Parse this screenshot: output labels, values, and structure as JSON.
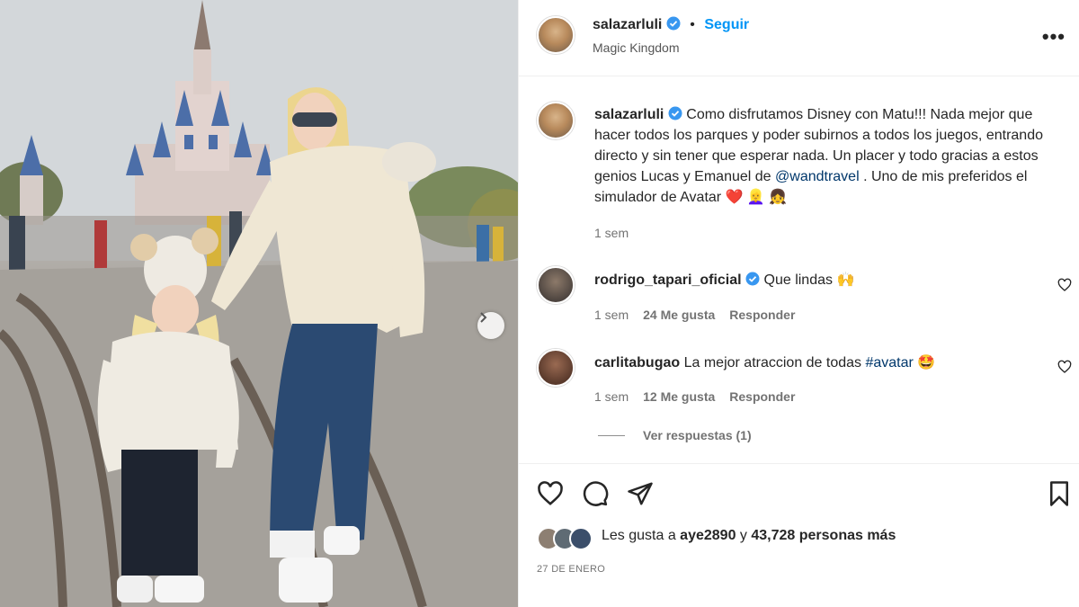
{
  "post": {
    "username": "salazarluli",
    "follow_label": "Seguir",
    "bullet": "•",
    "location": "Magic Kingdom",
    "more_label": "•••"
  },
  "caption": {
    "username": "salazarluli",
    "text_part1": "Como disfrutamos Disney con Matu!!! Nada mejor que hacer todos los parques y poder subirnos a todos los juegos, entrando directo y sin tener que esperar nada. Un placer y todo gracias a estos genios Lucas y Emanuel de ",
    "mention": "@wandtravel",
    "text_part2": " . Uno de mis preferidos el simulador de Avatar ",
    "emojis": "❤️ 👱‍♀️ 👧",
    "time": "1 sem"
  },
  "comments": [
    {
      "username": "rodrigo_tapari_oficial",
      "verified": true,
      "text": "Que lindas ",
      "emoji": "🙌",
      "time": "1 sem",
      "likes": "24 Me gusta",
      "reply": "Responder"
    },
    {
      "username": "carlitabugao",
      "verified": false,
      "text": "La mejor atraccion de todas ",
      "hashtag": "#avatar",
      "emoji": "🤩",
      "time": "1 sem",
      "likes": "12 Me gusta",
      "reply": "Responder"
    }
  ],
  "view_replies": "Ver respuestas (1)",
  "likes": {
    "prefix": "Les gusta a ",
    "user": "aye2890",
    "middle": " y ",
    "count": "43,728 personas más"
  },
  "date": "27 DE ENERO",
  "icons": {
    "verified": "verified-badge-icon",
    "like": "heart-icon",
    "comment": "comment-icon",
    "share": "paper-plane-icon",
    "save": "bookmark-icon",
    "next": "chevron-right-icon"
  },
  "colors": {
    "link_blue": "#0095f6",
    "mention_blue": "#00376b",
    "verified_blue": "#3897f0"
  }
}
